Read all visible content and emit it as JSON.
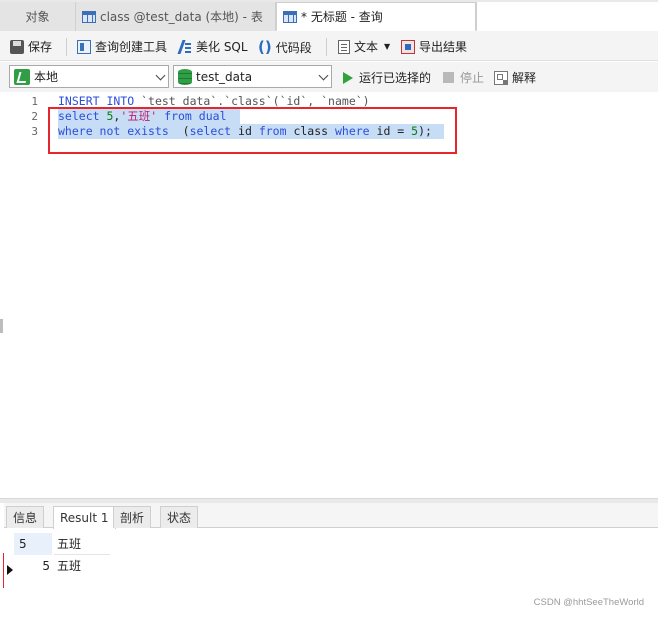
{
  "tabs": [
    {
      "label": "对象"
    },
    {
      "label": "class @test_data (本地) - 表"
    },
    {
      "label": "* 无标题 - 查询"
    }
  ],
  "toolbar": {
    "save": "保存",
    "query_builder": "查询创建工具",
    "beautify": "美化 SQL",
    "snippet": "代码段",
    "text": "文本",
    "export": "导出结果"
  },
  "connection": {
    "server": "本地",
    "database": "test_data",
    "run_selected": "运行已选择的",
    "stop": "停止",
    "explain": "解释"
  },
  "editor": {
    "line_numbers": [
      "1",
      "2",
      "3"
    ],
    "lines": [
      "INSERT INTO `test_data`.`class`(`id`, `name`)",
      "select 5,'五班' from dual",
      "where not exists  (select id from class where id = 5);"
    ]
  },
  "results": {
    "tabs": [
      "信息",
      "Result 1",
      "剖析",
      "状态"
    ],
    "active_tab": "Result 1",
    "header_row": [
      "5",
      "五班"
    ],
    "rows": [
      [
        "5",
        "五班"
      ]
    ]
  },
  "watermark": "CSDN @hhtSeeTheWorld",
  "colors": {
    "highlight_box": "#e5262d",
    "selection": "#c7dcf5",
    "keyword": "#2b4fd8",
    "string": "#c31d6d",
    "number": "#0a7d0a"
  }
}
